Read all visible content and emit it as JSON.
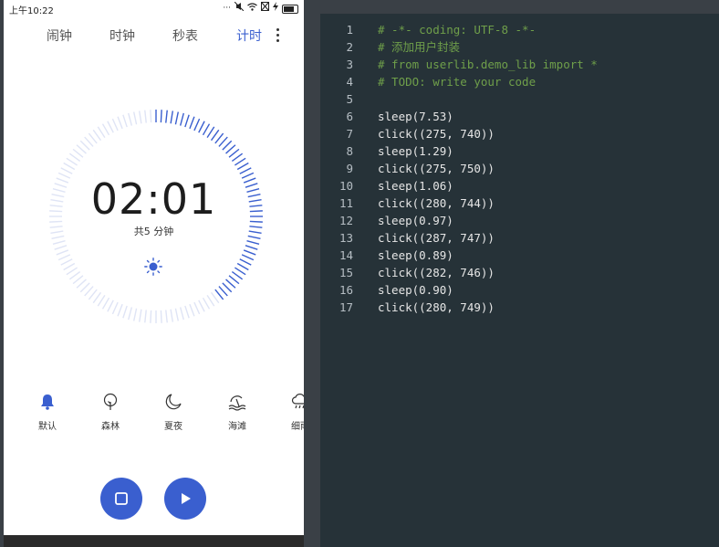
{
  "status_bar": {
    "time": "上午10:22"
  },
  "tabs": [
    {
      "label": "闹钟"
    },
    {
      "label": "时钟"
    },
    {
      "label": "秒表"
    },
    {
      "label": "计时"
    }
  ],
  "timer": {
    "display": "02:01",
    "total": "共5 分钟",
    "progress_fraction": 0.4
  },
  "sounds": [
    {
      "label": "默认",
      "icon": "bell-icon"
    },
    {
      "label": "森林",
      "icon": "tree-icon"
    },
    {
      "label": "夏夜",
      "icon": "moon-icon"
    },
    {
      "label": "海滩",
      "icon": "beach-icon"
    },
    {
      "label": "细雨",
      "icon": "rain-cloud-icon"
    }
  ],
  "controls": {
    "stop_icon": "stop-icon",
    "play_icon": "play-icon"
  },
  "colors": {
    "accent": "#3a5fcf",
    "editor_bg": "#263238",
    "comment": "#6f9f4a",
    "dial_track": "#dfe4f5"
  },
  "editor": {
    "lines": [
      {
        "n": "1",
        "text": "# -*- coding: UTF-8 -*-",
        "kind": "comment"
      },
      {
        "n": "2",
        "text": "# 添加用户封装",
        "kind": "comment"
      },
      {
        "n": "3",
        "text": "# from userlib.demo_lib import *",
        "kind": "comment"
      },
      {
        "n": "4",
        "text": "# TODO: write your code",
        "kind": "comment"
      },
      {
        "n": "5",
        "text": "",
        "kind": "code"
      },
      {
        "n": "6",
        "text": "sleep(7.53)",
        "kind": "code"
      },
      {
        "n": "7",
        "text": "click((275, 740))",
        "kind": "code"
      },
      {
        "n": "8",
        "text": "sleep(1.29)",
        "kind": "code"
      },
      {
        "n": "9",
        "text": "click((275, 750))",
        "kind": "code"
      },
      {
        "n": "10",
        "text": "sleep(1.06)",
        "kind": "code"
      },
      {
        "n": "11",
        "text": "click((280, 744))",
        "kind": "code"
      },
      {
        "n": "12",
        "text": "sleep(0.97)",
        "kind": "code"
      },
      {
        "n": "13",
        "text": "click((287, 747))",
        "kind": "code"
      },
      {
        "n": "14",
        "text": "sleep(0.89)",
        "kind": "code"
      },
      {
        "n": "15",
        "text": "click((282, 746))",
        "kind": "code"
      },
      {
        "n": "16",
        "text": "sleep(0.90)",
        "kind": "code"
      },
      {
        "n": "17",
        "text": "click((280, 749))",
        "kind": "code"
      }
    ]
  }
}
